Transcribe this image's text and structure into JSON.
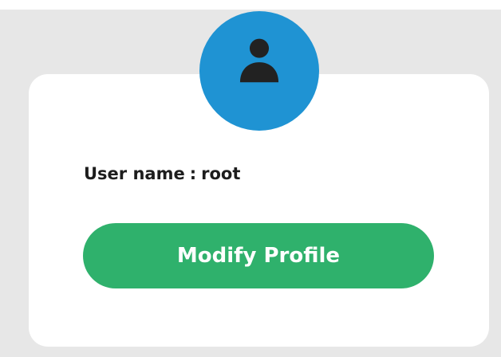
{
  "profile": {
    "username_label": "User name",
    "separator": ":",
    "username_value": "root",
    "modify_button_label": "Modify Profile",
    "avatar_icon": "user-icon"
  },
  "colors": {
    "background": "#e7e7e7",
    "card": "#ffffff",
    "avatar_bg": "#1f93d3",
    "avatar_icon": "#222222",
    "button_bg": "#2fb16c",
    "button_text": "#ffffff",
    "text": "#1d1d1d"
  }
}
